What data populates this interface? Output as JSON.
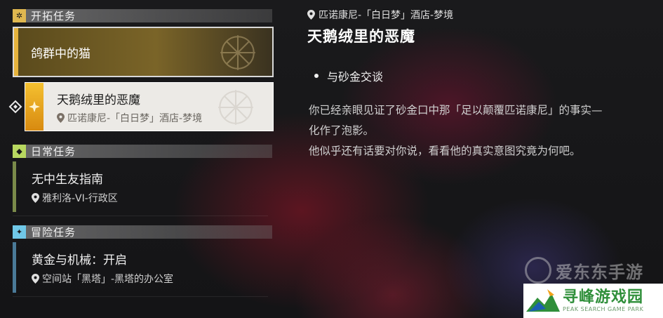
{
  "sections": {
    "trailblaze": {
      "header": "开拓任务",
      "quests": [
        {
          "title": "鸽群中的猫"
        },
        {
          "title": "天鹅绒里的恶魔",
          "location": "匹诺康尼-「白日梦」酒店-梦境",
          "selected": true
        }
      ]
    },
    "daily": {
      "header": "日常任务",
      "quests": [
        {
          "title": "无中生友指南",
          "location": "雅利洛-VI-行政区"
        }
      ]
    },
    "adventure": {
      "header": "冒险任务",
      "quests": [
        {
          "title": "黄金与机械：开启",
          "location": "空间站「黑塔」-黑塔的办公室"
        }
      ]
    }
  },
  "detail": {
    "location": "匹诺康尼-「白日梦」酒店-梦境",
    "title": "天鹅绒里的恶魔",
    "objective": "与砂金交谈",
    "description": [
      "你已经亲眼见证了砂金口中那「足以颠覆匹诺康尼」的事实—",
      "化作了泡影。",
      "他似乎还有话要对你说，看看他的真实意图究竟为何吧。"
    ]
  },
  "watermarks": {
    "top": "爱东东手游",
    "bottom_title": "寻峰游戏园",
    "bottom_subtitle": "PEAK SEARCH GAME PARK"
  },
  "colors": {
    "trailblaze": "#e0b850",
    "daily": "#b8d860",
    "adventure": "#70c8e8",
    "quest_gold": "#e6b33c"
  },
  "icons": [
    "trailblaze-icon",
    "daily-icon",
    "adventure-icon",
    "location-pin-icon",
    "selection-cursor-icon"
  ]
}
